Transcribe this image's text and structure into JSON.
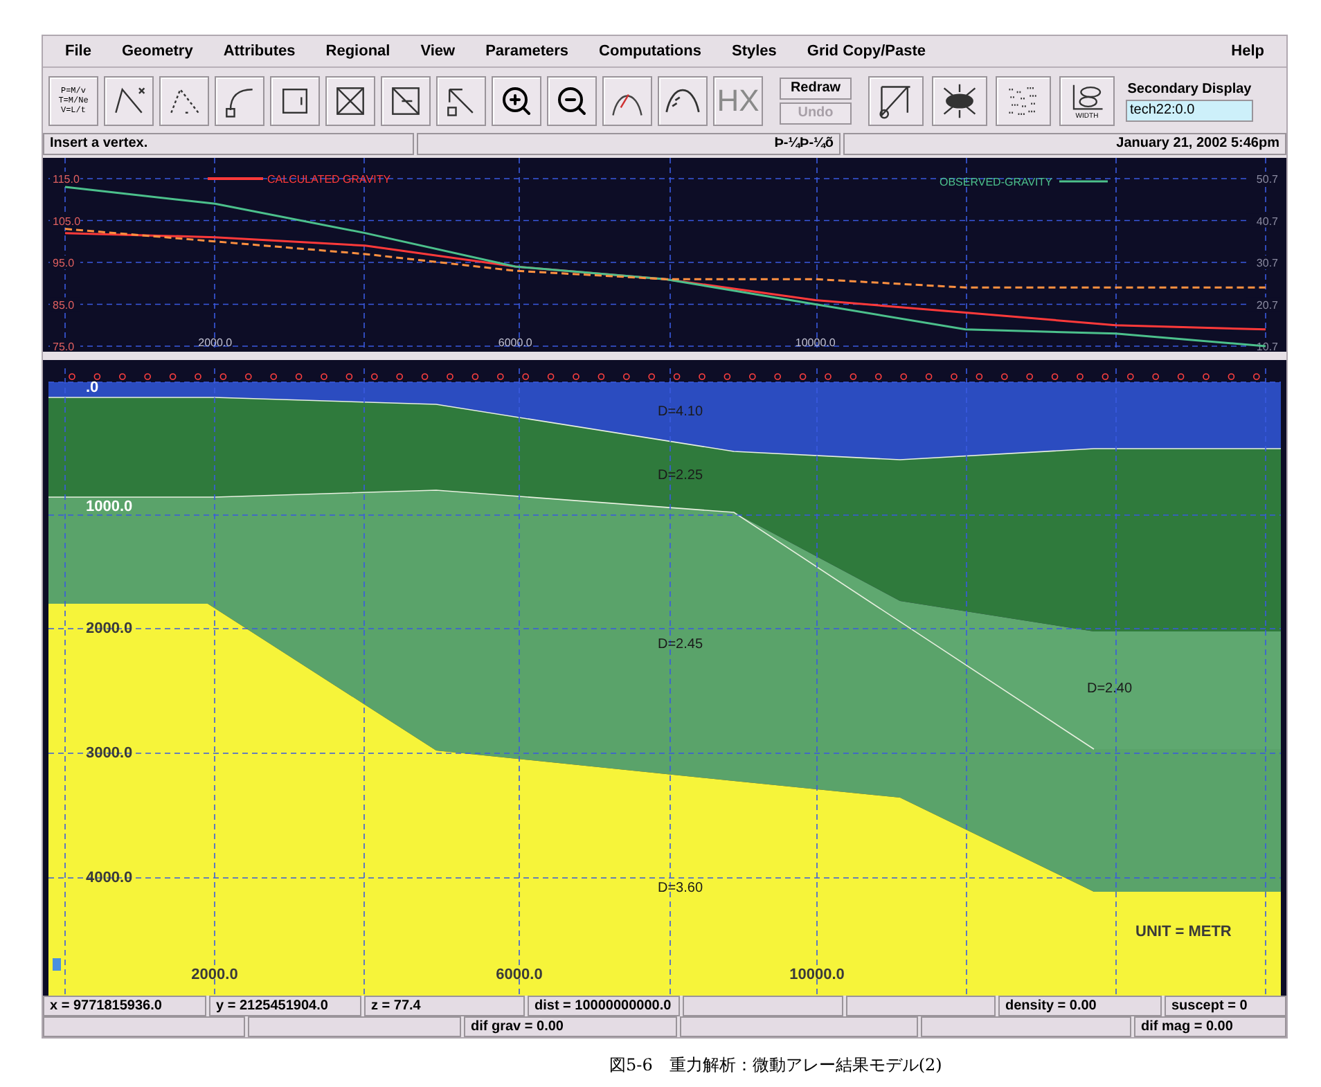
{
  "menu_bar": {
    "items": [
      "File",
      "Geometry",
      "Attributes",
      "Regional",
      "View",
      "Parameters",
      "Computations",
      "Styles",
      "Grid Copy/Paste"
    ],
    "help": "Help"
  },
  "toolbar": {
    "formula_lines": [
      "P=M/v",
      "T=M/Ne",
      "V=L/t"
    ],
    "hx_label": "HX",
    "redraw": "Redraw",
    "undo": {
      "label": "Undo",
      "disabled": true
    },
    "width_label": "WIDTH",
    "secondary_display": {
      "label": "Secondary Display",
      "value": "tech22:0.0"
    }
  },
  "status_line": {
    "message": "Insert a vertex.",
    "center": "Þ-¼Þ-¼õ",
    "date": "January 21, 2002 5:46pm"
  },
  "gravity_panel": {
    "chart_data": {
      "type": "line",
      "x": [
        0,
        2000,
        4000,
        6000,
        8000,
        10000,
        12000,
        14000,
        16000
      ],
      "xlim": [
        0,
        16000
      ],
      "ylim": [
        75,
        115
      ],
      "xticks": [
        {
          "value": 2000,
          "label": "2000.0"
        },
        {
          "value": 6000,
          "label": "6000.0"
        },
        {
          "value": 10000,
          "label": "10000.0"
        }
      ],
      "yticks": [
        {
          "value": 115,
          "label": "115.0"
        },
        {
          "value": 105,
          "label": "105.0"
        },
        {
          "value": 95,
          "label": "95.0"
        },
        {
          "value": 85,
          "label": "85.0"
        },
        {
          "value": 75,
          "label": "75.0"
        }
      ],
      "series": [
        {
          "name": "CALCULATED GRAVITY",
          "color": "#ff3a3a",
          "line_style": "solid",
          "values": [
            102,
            101,
            99,
            94,
            91,
            86,
            83,
            80,
            79
          ]
        },
        {
          "name": "OBSERVED-GRAVITY",
          "color": "#4cc08c",
          "line_style": "solid",
          "values": [
            113,
            109,
            102,
            94,
            91,
            85,
            79,
            78,
            75
          ]
        },
        {
          "color": "#ff9040",
          "line_style": "dashed",
          "values": [
            103,
            100,
            97,
            93,
            91,
            91,
            89,
            89,
            89
          ]
        }
      ],
      "grid": true
    },
    "right_axis_labels": [
      "50.7",
      "40.7",
      "30.7",
      "20.7",
      "10.7"
    ]
  },
  "section": {
    "depth_labels": [
      ".0",
      "1000.0",
      "2000.0",
      "3000.0",
      "4000.0"
    ],
    "distance_labels": [
      "2000.0",
      "6000.0",
      "10000.0"
    ],
    "layers": [
      {
        "label": "D=4.10",
        "color": "#2b4cc0"
      },
      {
        "label": "D=2.25",
        "color": "#2f7a3c"
      },
      {
        "label": "D=2.45",
        "color": "#5aa36a"
      },
      {
        "label": "D=2.40",
        "color": "#5fa870"
      },
      {
        "label": "D=3.60",
        "color": "#f6f43a"
      }
    ],
    "unit": "UNIT = METR"
  },
  "readouts": {
    "row_1": [
      "x = 9771815936.0",
      "y = 2125451904.0",
      "z = 77.4",
      "dist = 10000000000.0",
      "density = 0.00",
      "suscept = 0"
    ],
    "row_2": [
      "dif grav = 0.00",
      "dif mag = 0.00"
    ]
  },
  "caption": "図5-6　重力解析：微動アレー結果モデル(2)"
}
